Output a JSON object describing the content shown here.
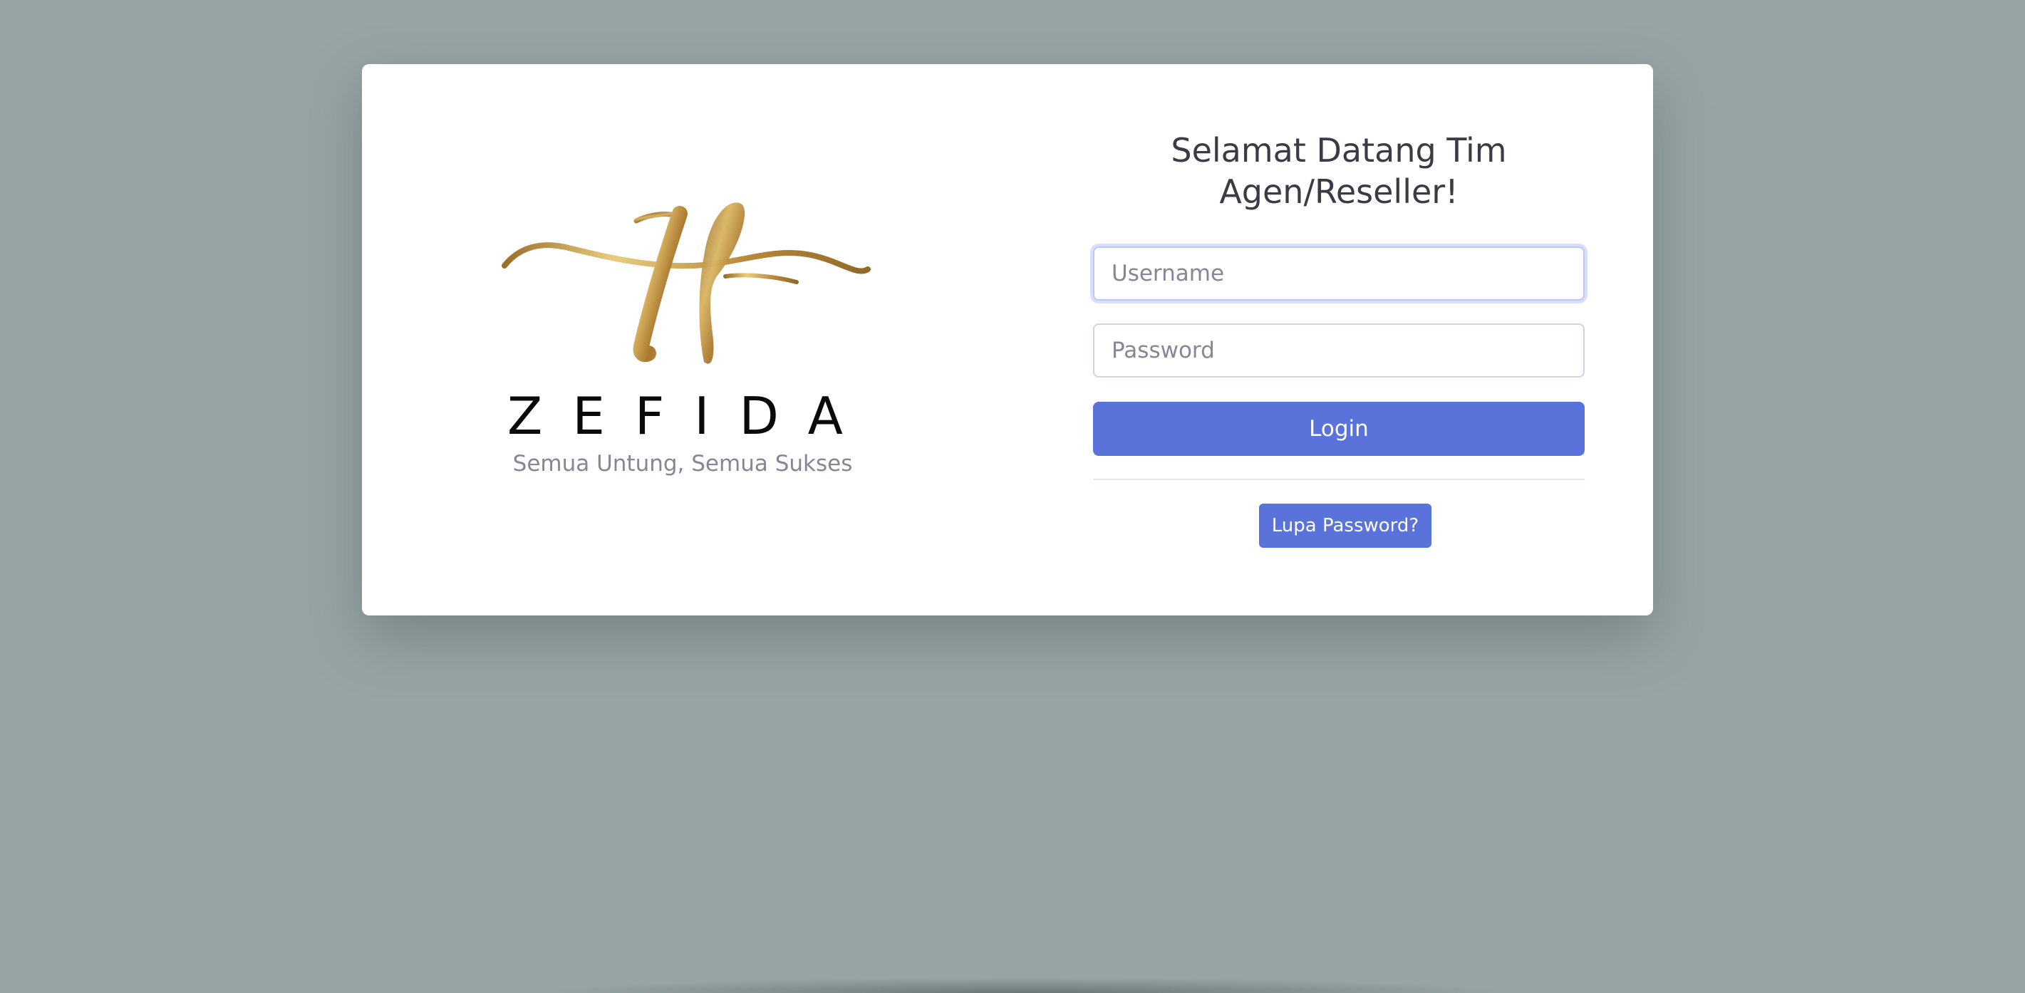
{
  "brand": {
    "logo_icon": "zf-monogram-logo",
    "name": "ZEFIDA",
    "tagline": "Semua Untung, Semua Sukses",
    "logo_color": "#b98d3e"
  },
  "login": {
    "heading": "Selamat Datang Tim Agen/Reseller!",
    "username_placeholder": "Username",
    "password_placeholder": "Password",
    "login_label": "Login",
    "forgot_label": "Lupa Password?"
  },
  "colors": {
    "background": "#97a4a5",
    "card": "#ffffff",
    "primary": "#5a73db",
    "heading_text": "#3a3b45",
    "muted_text": "#858796"
  }
}
